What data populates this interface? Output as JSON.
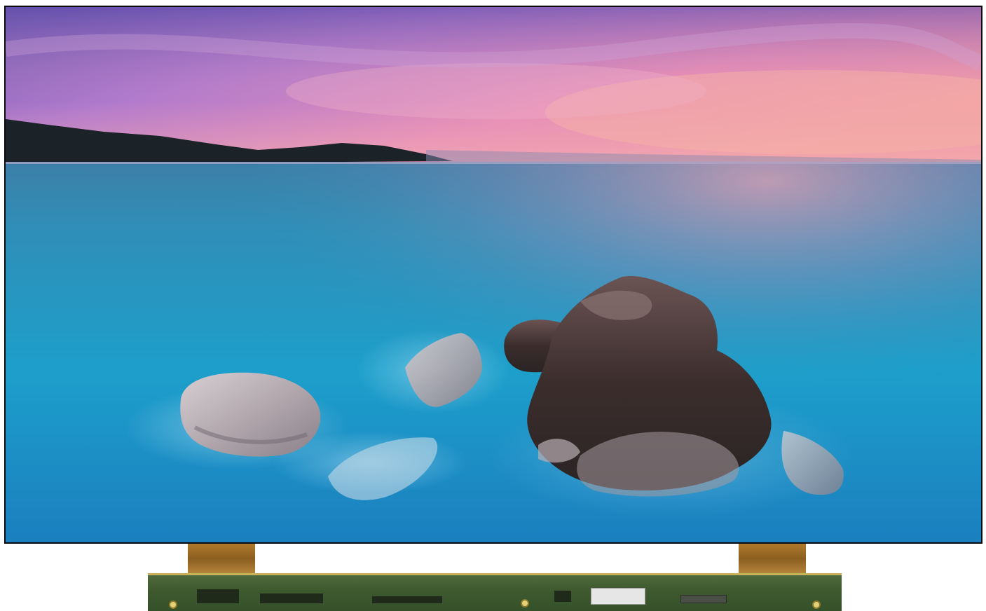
{
  "scene": {
    "subject": "tv-lcd-panel",
    "screen_image": "seascape-sunset-rocks",
    "colors": {
      "sky_top": "#7a5fb8",
      "sky_pink": "#e58ab6",
      "horizon_glow": "#f2a4a8",
      "sea_deep": "#0f86b6",
      "sea_light": "#39b2d6",
      "rocks": "#3a2e2d",
      "bezel": "#0c0c0e",
      "flex_cable": "#a9742c",
      "pcb_green": "#3f5a2f"
    }
  }
}
